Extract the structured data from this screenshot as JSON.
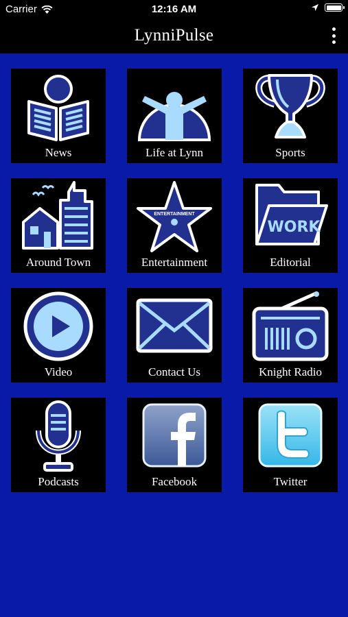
{
  "status_bar": {
    "carrier": "Carrier",
    "time": "12:16 AM"
  },
  "app": {
    "title": "LynniPulse"
  },
  "colors": {
    "background": "#0a1aa8",
    "tile": "#000000",
    "icon_fill": "#22318f",
    "icon_light": "#a9dbff"
  },
  "tiles": [
    {
      "label": "News",
      "icon": "newspaper-reader-icon"
    },
    {
      "label": "Life at Lynn",
      "icon": "cheering-person-icon"
    },
    {
      "label": "Sports",
      "icon": "trophy-icon"
    },
    {
      "label": "Around Town",
      "icon": "town-buildings-icon"
    },
    {
      "label": "Entertainment",
      "icon": "star-icon",
      "icon_text": "ENTERTAINMENT"
    },
    {
      "label": "Editorial",
      "icon": "folder-icon",
      "icon_text": "WORK"
    },
    {
      "label": "Video",
      "icon": "play-icon"
    },
    {
      "label": "Contact Us",
      "icon": "envelope-icon"
    },
    {
      "label": "Knight Radio",
      "icon": "radio-icon"
    },
    {
      "label": "Podcasts",
      "icon": "microphone-icon"
    },
    {
      "label": "Facebook",
      "icon": "facebook-icon"
    },
    {
      "label": "Twitter",
      "icon": "twitter-icon"
    }
  ]
}
